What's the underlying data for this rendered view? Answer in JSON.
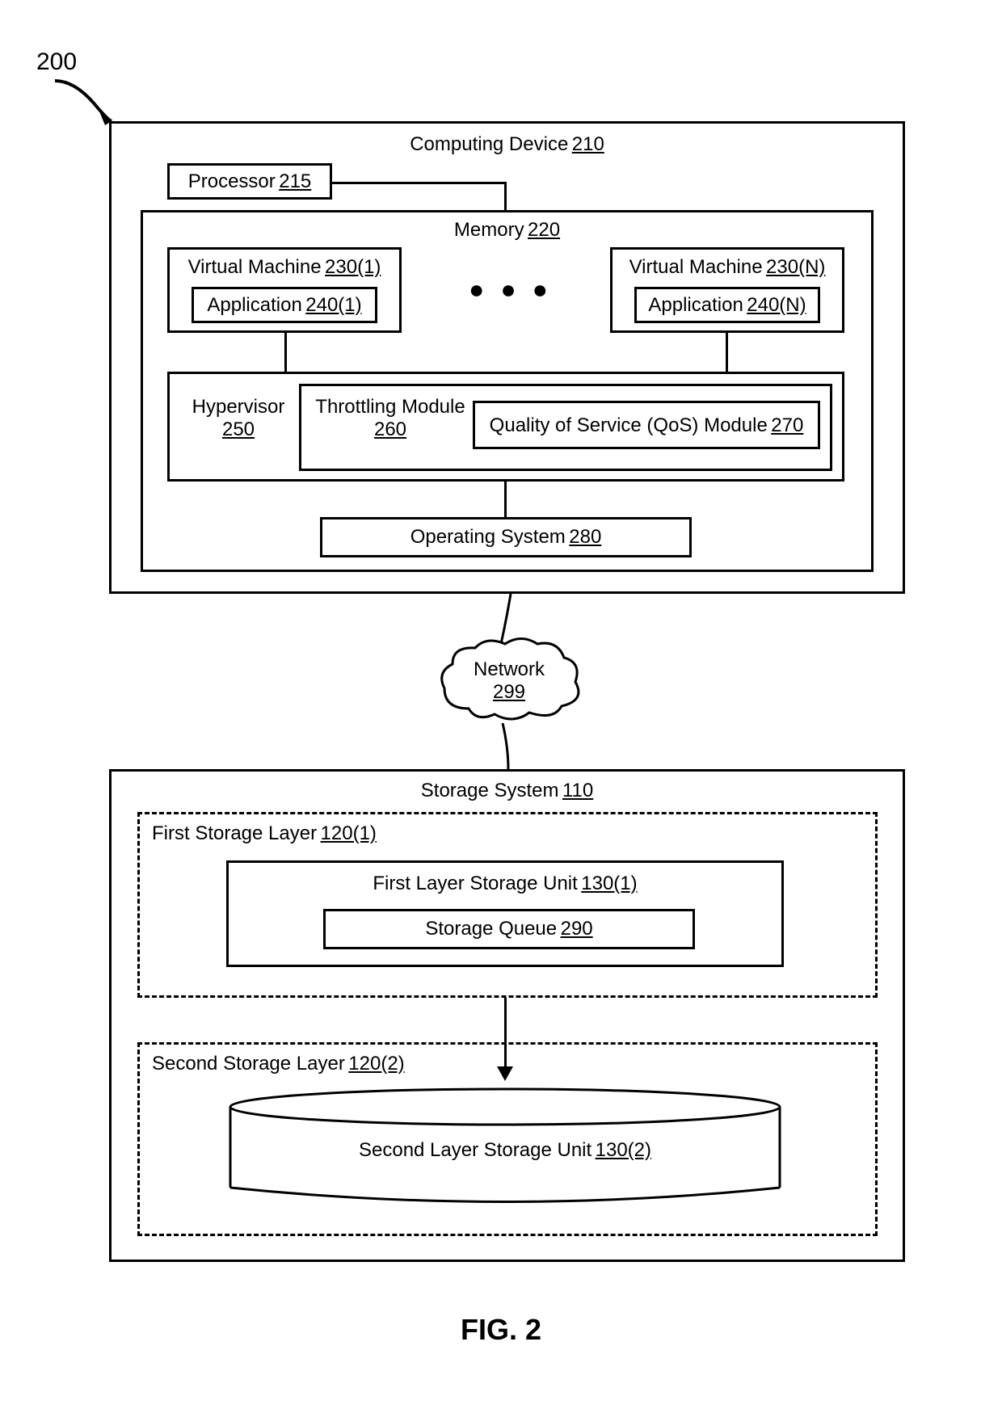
{
  "callout_200": "200",
  "computing_device": {
    "label": "Computing Device",
    "ref": "210"
  },
  "processor": {
    "label": "Processor",
    "ref": "215"
  },
  "memory": {
    "label": "Memory",
    "ref": "220"
  },
  "vm1": {
    "label": "Virtual Machine",
    "ref": "230(1)"
  },
  "app1": {
    "label": "Application",
    "ref": "240(1)"
  },
  "vmN": {
    "label": "Virtual Machine",
    "ref": "230(N)"
  },
  "appN": {
    "label": "Application",
    "ref": "240(N)"
  },
  "hypervisor": {
    "label": "Hypervisor",
    "ref": "250"
  },
  "throttling": {
    "label": "Throttling Module",
    "ref": "260"
  },
  "qos": {
    "label": "Quality of Service (QoS) Module",
    "ref": "270"
  },
  "os": {
    "label": "Operating System",
    "ref": "280"
  },
  "network": {
    "label": "Network",
    "ref": "299"
  },
  "storage_system": {
    "label": "Storage System",
    "ref": "110"
  },
  "first_layer": {
    "label": "First Storage Layer",
    "ref": "120(1)"
  },
  "first_unit": {
    "label": "First Layer Storage Unit",
    "ref": "130(1)"
  },
  "storage_queue": {
    "label": "Storage Queue",
    "ref": "290"
  },
  "second_layer": {
    "label": "Second Storage Layer",
    "ref": "120(2)"
  },
  "second_unit": {
    "label": "Second Layer Storage Unit",
    "ref": "130(2)"
  },
  "figure": "FIG. 2"
}
